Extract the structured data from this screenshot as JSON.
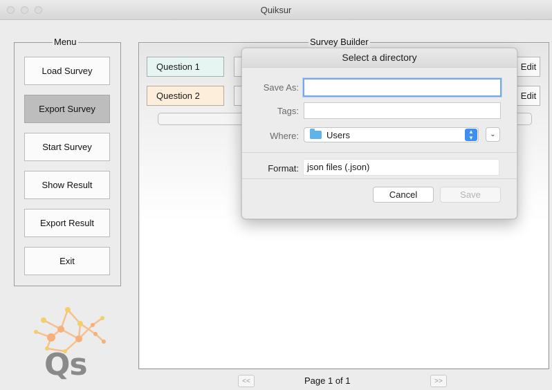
{
  "window": {
    "title": "Quiksur"
  },
  "menu": {
    "title": "Menu",
    "items": [
      {
        "label": "Load Survey"
      },
      {
        "label": "Export Survey"
      },
      {
        "label": "Start Survey"
      },
      {
        "label": "Show Result"
      },
      {
        "label": "Export Result"
      },
      {
        "label": "Exit"
      }
    ]
  },
  "logo": {
    "text": "Qs"
  },
  "builder": {
    "title": "Survey Builder",
    "questions": [
      {
        "label": "Question 1",
        "color": "#e6f5f1",
        "edit": "Edit"
      },
      {
        "label": "Question 2",
        "color": "#fdeedc",
        "edit": "Edit"
      }
    ],
    "pagination": {
      "prev": "<<",
      "label": "Page 1 of 1",
      "next": ">>"
    }
  },
  "dialog": {
    "title": "Select a directory",
    "save_as_label": "Save As:",
    "save_as_value": "",
    "tags_label": "Tags:",
    "tags_value": "",
    "where_label": "Where:",
    "where_value": "Users",
    "format_label": "Format:",
    "format_value": "json files (.json)",
    "cancel": "Cancel",
    "save": "Save"
  },
  "colors": {
    "focus_ring": "#7aa7e6",
    "stepper": "#3d8ff5",
    "folder": "#5eb3ea",
    "logo_orange": "#f6b07a",
    "logo_yellow": "#f1cf69",
    "logo_gray": "#8a8a8a"
  }
}
